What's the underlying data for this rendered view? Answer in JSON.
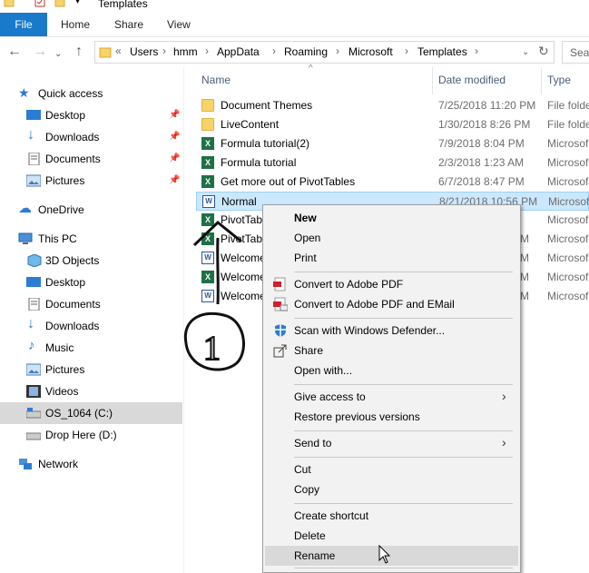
{
  "window": {
    "title": "Templates"
  },
  "ribbon": {
    "file_label": "File",
    "tabs": [
      "Home",
      "Share",
      "View"
    ]
  },
  "address": {
    "prefix": "«",
    "segments": [
      "Users",
      "hmm",
      "AppData",
      "Roaming",
      "Microsoft",
      "Templates"
    ],
    "search_placeholder": "Sear"
  },
  "navpane": {
    "items": [
      {
        "label": "Quick access",
        "icon": "star-icon"
      },
      {
        "label": "Desktop",
        "icon": "desktop-icon",
        "pinned": true
      },
      {
        "label": "Downloads",
        "icon": "download-arrow-icon",
        "pinned": true
      },
      {
        "label": "Documents",
        "icon": "documents-icon",
        "pinned": true
      },
      {
        "label": "Pictures",
        "icon": "pictures-icon",
        "pinned": true
      },
      {
        "label": "OneDrive",
        "icon": "cloud-icon"
      },
      {
        "label": "This PC",
        "icon": "computer-icon"
      },
      {
        "label": "3D Objects",
        "icon": "cube-icon"
      },
      {
        "label": "Desktop",
        "icon": "desktop-icon"
      },
      {
        "label": "Documents",
        "icon": "documents-icon"
      },
      {
        "label": "Downloads",
        "icon": "download-arrow-icon"
      },
      {
        "label": "Music",
        "icon": "music-note-icon"
      },
      {
        "label": "Pictures",
        "icon": "pictures-icon"
      },
      {
        "label": "Videos",
        "icon": "film-icon"
      },
      {
        "label": "OS_1064 (C:)",
        "icon": "drive-icon",
        "selected": true
      },
      {
        "label": "Drop Here (D:)",
        "icon": "drive-icon"
      },
      {
        "label": "Network",
        "icon": "network-icon"
      }
    ]
  },
  "filelist": {
    "columns": {
      "name": "Name",
      "date": "Date modified",
      "type": "Type"
    },
    "rows": [
      {
        "name": "Document Themes",
        "date": "7/25/2018 11:20 PM",
        "type": "File folde",
        "icon": "folder"
      },
      {
        "name": "LiveContent",
        "date": "1/30/2018 8:26 PM",
        "type": "File folde",
        "icon": "folder"
      },
      {
        "name": "Formula tutorial(2)",
        "date": "7/9/2018 8:04 PM",
        "type": "Microsof",
        "icon": "excel"
      },
      {
        "name": "Formula tutorial",
        "date": "2/3/2018 1:23 AM",
        "type": "Microsof",
        "icon": "excel"
      },
      {
        "name": "Get more out of PivotTables",
        "date": "6/7/2018 8:47 PM",
        "type": "Microsof",
        "icon": "excel"
      },
      {
        "name": "Normal",
        "date": "8/21/2018 10:56 PM",
        "type": "Microsof",
        "icon": "word",
        "selected": true
      },
      {
        "name": "PivotTab",
        "date": "",
        "type": "Microsof",
        "icon": "excel"
      },
      {
        "name": "PivotTab",
        "date": "M",
        "type": "Microsof",
        "icon": "excel"
      },
      {
        "name": "Welcome",
        "date": "M",
        "type": "Microsof",
        "icon": "word"
      },
      {
        "name": "Welcome",
        "date": "M",
        "type": "Microsof",
        "icon": "excel"
      },
      {
        "name": "Welcome",
        "date": "M",
        "type": "Microsof",
        "icon": "word"
      }
    ]
  },
  "contextmenu": {
    "items": [
      {
        "label": "New",
        "bold": true
      },
      {
        "label": "Open"
      },
      {
        "label": "Print"
      },
      {
        "label": "Convert to Adobe PDF",
        "icon": "pdf-icon"
      },
      {
        "label": "Convert to Adobe PDF and EMail",
        "icon": "pdf-mail-icon"
      },
      {
        "label": "Scan with Windows Defender...",
        "icon": "shield-icon"
      },
      {
        "label": "Share",
        "icon": "share-icon"
      },
      {
        "label": "Open with..."
      },
      {
        "label": "Give access to",
        "submenu": true
      },
      {
        "label": "Restore previous versions"
      },
      {
        "label": "Send to",
        "submenu": true
      },
      {
        "label": "Cut"
      },
      {
        "label": "Copy"
      },
      {
        "label": "Create shortcut"
      },
      {
        "label": "Delete"
      },
      {
        "label": "Rename",
        "hover": true
      }
    ]
  },
  "annotation": {
    "step_number": "1"
  },
  "colors": {
    "accent": "#1979ca",
    "selection": "#cce8ff",
    "menu_bg": "#f2f2f2"
  }
}
